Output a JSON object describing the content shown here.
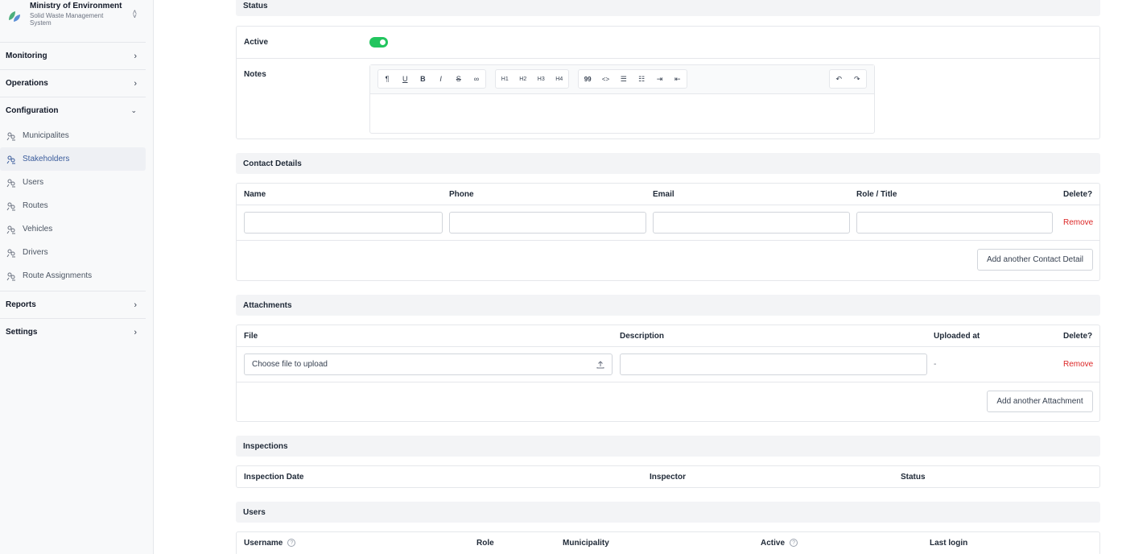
{
  "brand": {
    "title": "Ministry of Environment",
    "subtitle": "Solid Waste Management System"
  },
  "sidebar": {
    "groups": [
      {
        "label": "Monitoring",
        "chevron": "›"
      },
      {
        "label": "Operations",
        "chevron": "›"
      },
      {
        "label": "Configuration",
        "chevron": "⌄"
      },
      {
        "label": "Reports",
        "chevron": "›"
      },
      {
        "label": "Settings",
        "chevron": "›"
      }
    ],
    "config_items": [
      {
        "label": "Municipalites",
        "icon": "users-icon"
      },
      {
        "label": "Stakeholders",
        "icon": "users-icon",
        "active": true
      },
      {
        "label": "Users",
        "icon": "users-icon"
      },
      {
        "label": "Routes",
        "icon": "users-icon"
      },
      {
        "label": "Vehicles",
        "icon": "users-icon"
      },
      {
        "label": "Drivers",
        "icon": "users-icon"
      },
      {
        "label": "Route Assignments",
        "icon": "users-icon"
      }
    ]
  },
  "status": {
    "heading": "Status",
    "active_label": "Active",
    "active_value": true,
    "notes_label": "Notes",
    "toolbar": {
      "group1": [
        "¶",
        "U",
        "B",
        "I",
        "S",
        "∞"
      ],
      "group2": [
        "H1",
        "H2",
        "H3",
        "H4"
      ],
      "group3": [
        "99",
        "<>",
        "☰",
        "☷",
        "⇥",
        "⇤"
      ],
      "group4": [
        "↶",
        "↷"
      ]
    }
  },
  "contacts": {
    "heading": "Contact Details",
    "columns": [
      "Name",
      "Phone",
      "Email",
      "Role / Title",
      "Delete?"
    ],
    "remove_label": "Remove",
    "add_label": "Add another Contact Detail"
  },
  "attachments": {
    "heading": "Attachments",
    "columns": [
      "File",
      "Description",
      "Uploaded at",
      "Delete?"
    ],
    "file_placeholder": "Choose file to upload",
    "uploaded_value": "-",
    "remove_label": "Remove",
    "add_label": "Add another Attachment"
  },
  "inspections": {
    "heading": "Inspections",
    "columns": [
      "Inspection Date",
      "Inspector",
      "Status"
    ]
  },
  "users": {
    "heading": "Users",
    "columns": [
      "Username",
      "Role",
      "Municipality",
      "Active",
      "Last login"
    ]
  },
  "colors": {
    "accent": "#3b5c9c",
    "toggle_on": "#22c55e",
    "danger": "#dc2626"
  }
}
